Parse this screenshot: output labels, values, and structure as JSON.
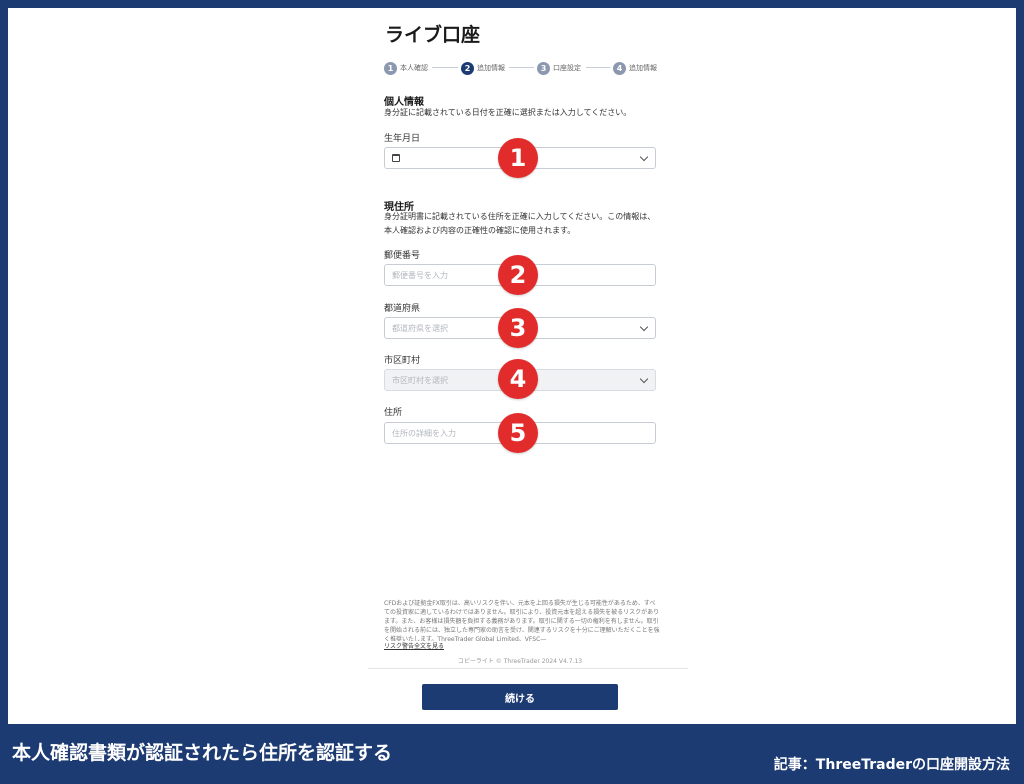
{
  "page": {
    "title": "ライブ口座"
  },
  "stepper": {
    "steps": [
      {
        "num": "1",
        "label": "本人確認"
      },
      {
        "num": "2",
        "label": "追加情報"
      },
      {
        "num": "3",
        "label": "口座設定"
      },
      {
        "num": "4",
        "label": "追加情報"
      }
    ],
    "active_step": 2
  },
  "personal": {
    "title": "個人情報",
    "desc": "身分証に記載されている日付を正確に選択または入力してください。",
    "dob_label": "生年月日"
  },
  "address": {
    "title": "現住所",
    "desc": "身分証明書に記載されている住所を正確に入力してください。この情報は、本人確認および内容の正確性の確認に使用されます。",
    "postal_label": "郵便番号",
    "postal_placeholder": "郵便番号を入力",
    "prefecture_label": "都道府県",
    "prefecture_placeholder": "都道府県を選択",
    "city_label": "市区町村",
    "city_placeholder": "市区町村を選択",
    "street_label": "住所",
    "street_placeholder": "住所の詳細を入力"
  },
  "badges": [
    "1",
    "2",
    "3",
    "4",
    "5"
  ],
  "footer": {
    "disclaimer": "CFDおよび証拠金FX取引は、高いリスクを伴い、元本を上回る損失が生じる可能性があるため、すべての投資家に適しているわけではありません。取引により、投資元本を超える損失を被るリスクがあります。また、お客様は損失額を負担する義務があります。取引に関する一切の権利を有しません。取引を開始される前には、独立した専門家の助言を受け、関連するリスクを十分にご理解いただくことを強く推奨いたします。ThreeTrader Global Limited、VFSC—",
    "risk_link": "リスク警告全文を見る",
    "copyright": "コピーライト © ThreeTrader 2024 V4.7.13"
  },
  "continue_label": "続ける",
  "caption": "本人確認書類が認証されたら住所を認証する",
  "article": "記事：ThreeTraderの口座開設方法",
  "colors": {
    "navy": "#1d3b73",
    "badge_red": "#e22b2b"
  }
}
